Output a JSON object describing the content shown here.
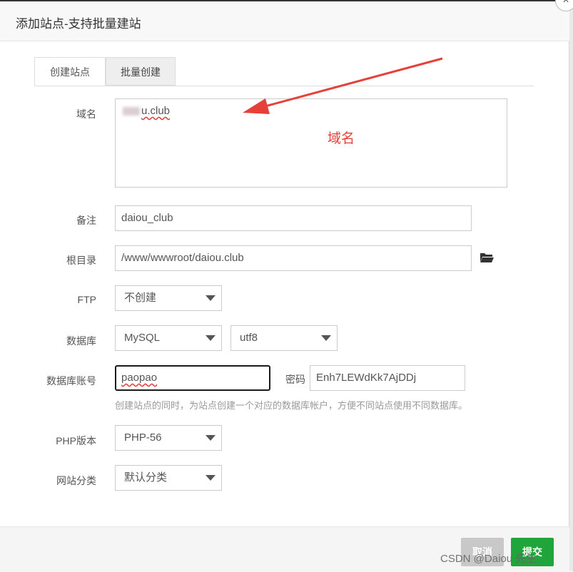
{
  "dialog": {
    "title": "添加站点-支持批量建站",
    "close_icon": "×"
  },
  "tabs": [
    {
      "label": "创建站点",
      "active": true
    },
    {
      "label": "批量创建",
      "active": false
    }
  ],
  "form": {
    "domain": {
      "label": "域名",
      "value_visible": "u.club"
    },
    "annotation": "域名",
    "remark": {
      "label": "备注",
      "value": "daiou_club"
    },
    "root": {
      "label": "根目录",
      "value": "/www/wwwroot/daiou.club",
      "icon": "folder-open-icon"
    },
    "ftp": {
      "label": "FTP",
      "value": "不创建"
    },
    "database": {
      "label": "数据库",
      "type": "MySQL",
      "charset": "utf8"
    },
    "db_account": {
      "label": "数据库账号",
      "value": "paopao",
      "password_label": "密码",
      "password": "Enh7LEWdKk7AjDDj",
      "hint": "创建站点的同时，为站点创建一个对应的数据库帐户，方便不同站点使用不同数据库。"
    },
    "php": {
      "label": "PHP版本",
      "value": "PHP-56"
    },
    "category": {
      "label": "网站分类",
      "value": "默认分类"
    }
  },
  "footer": {
    "cancel_label": "取消",
    "submit_label": "提交"
  },
  "watermark": "CSDN @Daiou 先生",
  "colors": {
    "accent": "#20a53a",
    "annotation": "#e5413a"
  }
}
